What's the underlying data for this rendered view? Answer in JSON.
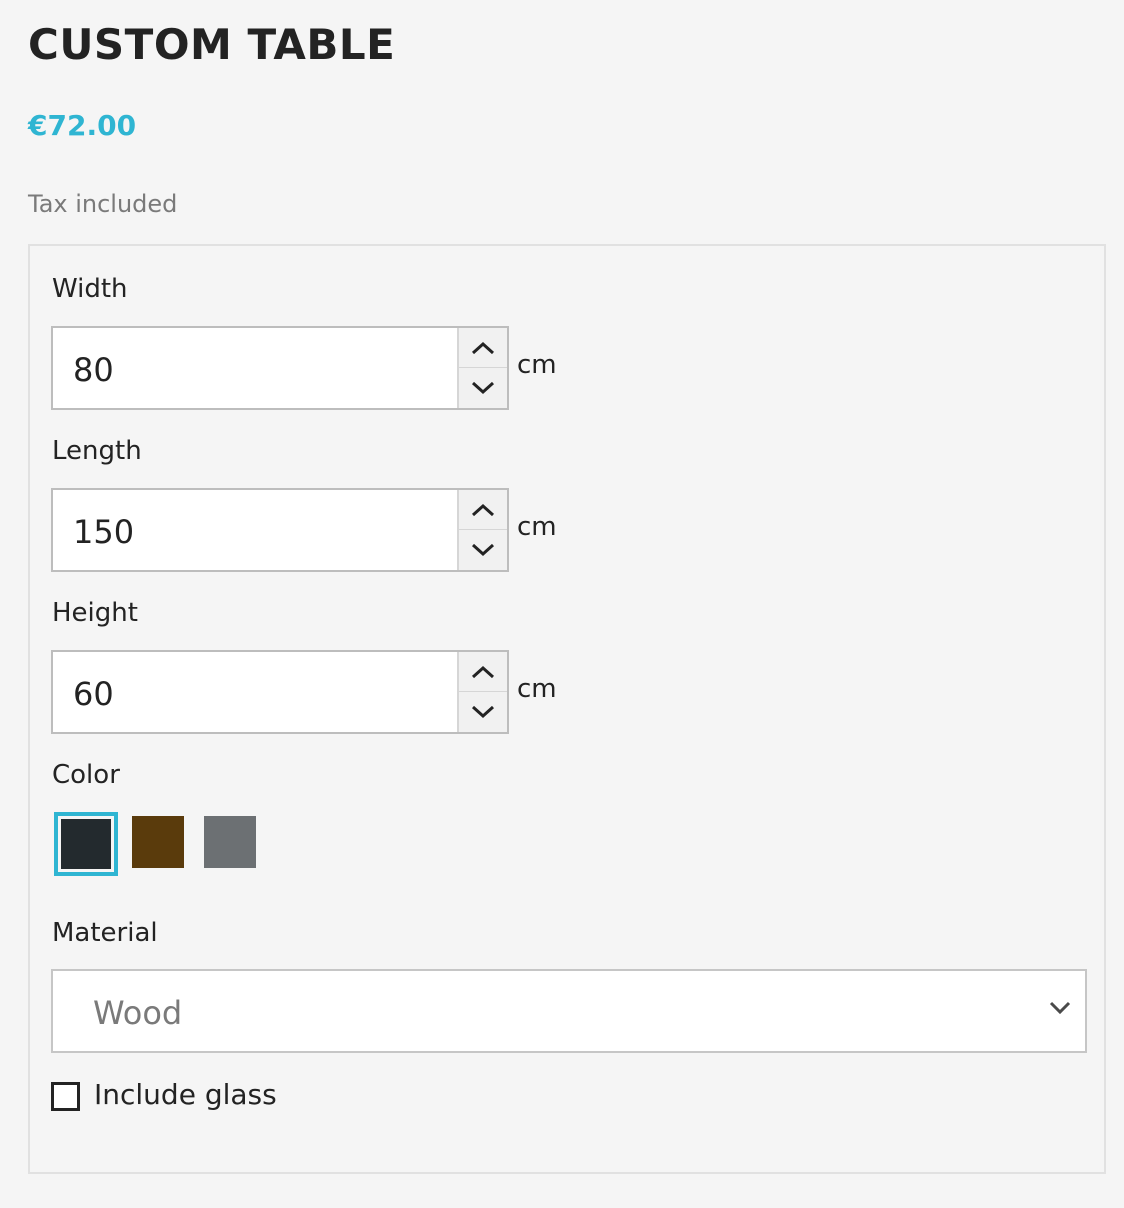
{
  "product": {
    "title": "CUSTOM TABLE",
    "price": "€72.00",
    "tax_note": "Tax included"
  },
  "customizer": {
    "fields": [
      {
        "label": "Width",
        "value": "80",
        "unit": "cm"
      },
      {
        "label": "Length",
        "value": "150",
        "unit": "cm"
      },
      {
        "label": "Height",
        "value": "60",
        "unit": "cm"
      }
    ],
    "color": {
      "label": "Color",
      "swatches": [
        {
          "name": "dark",
          "hex": "#232a2e",
          "selected": true
        },
        {
          "name": "brown",
          "hex": "#5a3b0c",
          "selected": false
        },
        {
          "name": "gray",
          "hex": "#6c7073",
          "selected": false
        }
      ],
      "selected_border": "#2fb5d2"
    },
    "material": {
      "label": "Material",
      "selected": "Wood"
    },
    "glass": {
      "label": "Include glass",
      "checked": false
    }
  },
  "colors": {
    "accent": "#2fb5d2",
    "text": "#232323",
    "muted": "#7a7a7a",
    "background": "#f5f5f5"
  },
  "icons": {
    "spinner_up": "chevron-up-icon",
    "spinner_down": "chevron-down-icon",
    "select": "chevron-down-icon"
  }
}
